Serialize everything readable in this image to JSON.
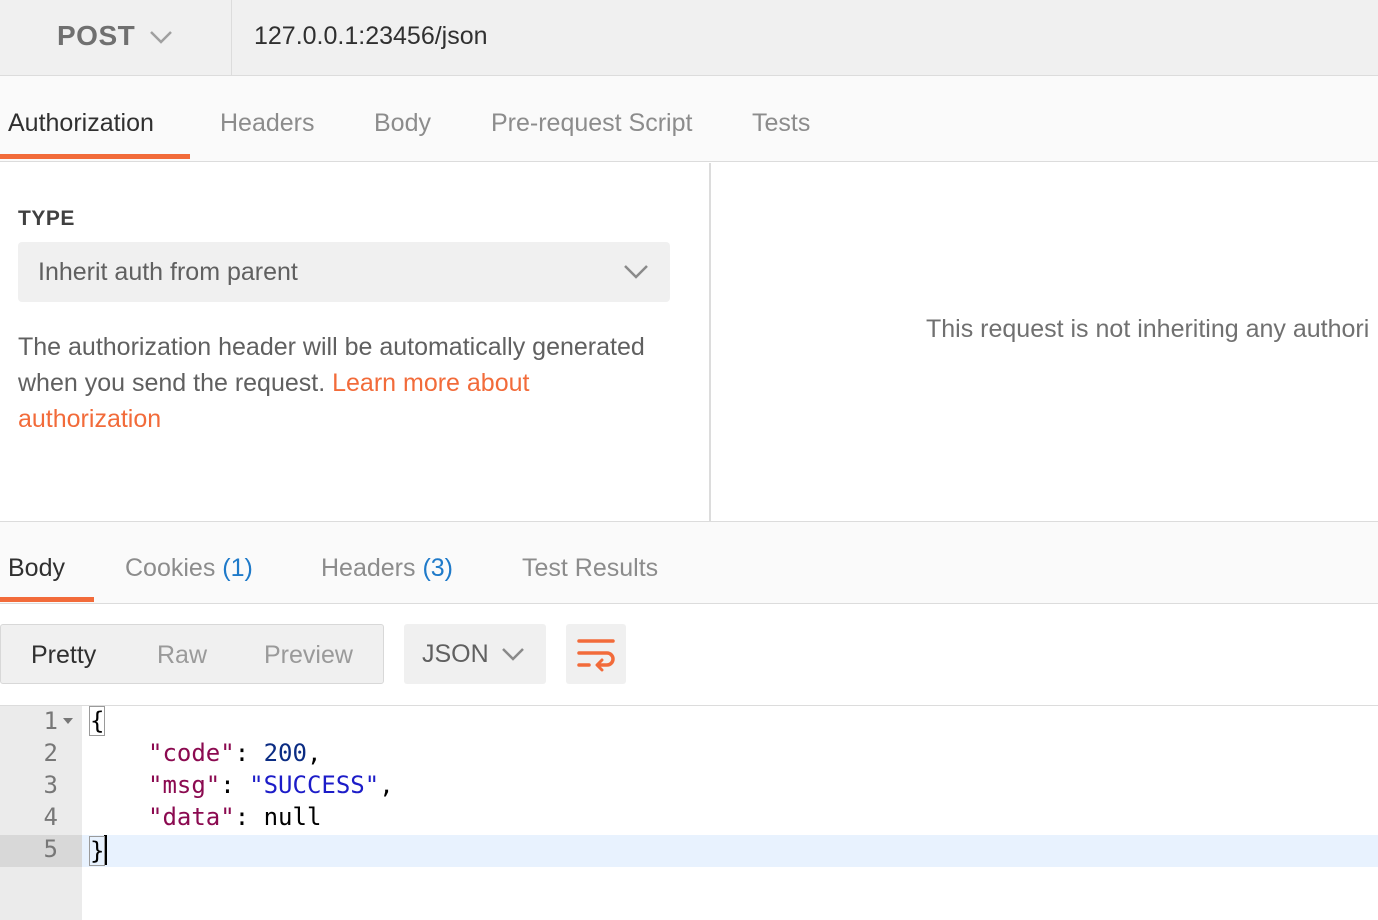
{
  "request": {
    "method": "POST",
    "url": "127.0.0.1:23456/json"
  },
  "request_tabs": [
    {
      "label": "Authorization",
      "active": true
    },
    {
      "label": "Headers",
      "active": false
    },
    {
      "label": "Body",
      "active": false
    },
    {
      "label": "Pre-request Script",
      "active": false
    },
    {
      "label": "Tests",
      "active": false
    }
  ],
  "auth": {
    "type_label": "TYPE",
    "type_value": "Inherit auth from parent",
    "description": "The authorization header will be automatically generated when you send the request. ",
    "link_text": "Learn more about authorization",
    "right_message": "This request is not inheriting any authori"
  },
  "response_tabs": [
    {
      "label": "Body",
      "count": "",
      "active": true
    },
    {
      "label": "Cookies",
      "count": "(1)",
      "active": false
    },
    {
      "label": "Headers",
      "count": "(3)",
      "active": false
    },
    {
      "label": "Test Results",
      "count": "",
      "active": false
    }
  ],
  "view_modes": [
    {
      "label": "Pretty",
      "active": true
    },
    {
      "label": "Raw",
      "active": false
    },
    {
      "label": "Preview",
      "active": false
    }
  ],
  "format": "JSON",
  "icons": {
    "method_dropdown": "chevron-down-icon",
    "type_dropdown": "chevron-down-icon",
    "format_dropdown": "chevron-down-icon",
    "wrap": "wrap-lines-icon"
  },
  "colors": {
    "accent": "#f26b3a",
    "count": "#1f7ac9",
    "json_key": "#8b0a50",
    "json_string": "#1c1cc8",
    "json_number": "#0b2c83"
  },
  "editor": {
    "line_numbers": [
      "1",
      "2",
      "3",
      "4",
      "5"
    ],
    "lines": [
      {
        "open": "{"
      },
      {
        "key": "\"code\"",
        "sep": ": ",
        "value": "200",
        "value_type": "number",
        "tail": ","
      },
      {
        "key": "\"msg\"",
        "sep": ": ",
        "value": "\"SUCCESS\"",
        "value_type": "string",
        "tail": ","
      },
      {
        "key": "\"data\"",
        "sep": ": ",
        "value": "null",
        "value_type": "null",
        "tail": ""
      },
      {
        "close": "}"
      }
    ]
  }
}
